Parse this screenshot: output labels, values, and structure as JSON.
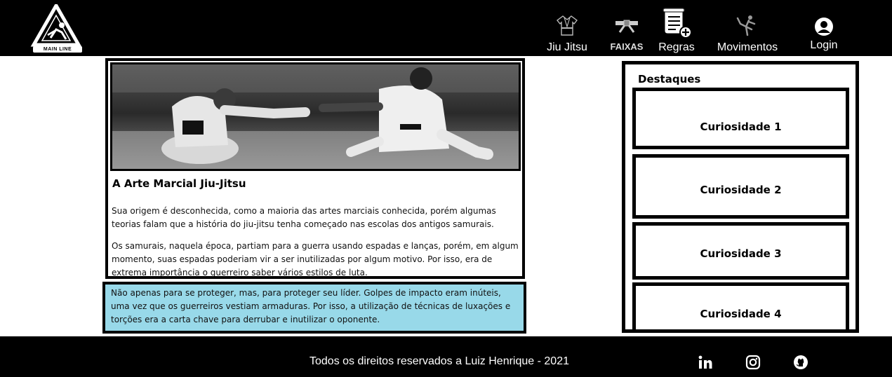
{
  "header": {
    "logo_text": "MAIN LINE",
    "nav": [
      {
        "label": "Jiu Jitsu",
        "icon": "gi-icon"
      },
      {
        "label": "FAIXAS",
        "icon": "belt-icon"
      },
      {
        "label": "Regras",
        "icon": "rules-scroll-icon"
      },
      {
        "label": "Movimentos",
        "icon": "kick-icon"
      },
      {
        "label": "Login",
        "icon": "user-icon"
      }
    ]
  },
  "article": {
    "title": "A Arte Marcial Jiu-Jitsu",
    "paragraphs": [
      "Sua origem é desconhecida, como a maioria das artes marciais conhecida, porém algumas teorias falam que a história do jiu-jitsu tenha começado nas escolas dos antigos samurais.",
      "Os samurais, naquela época, partiam para a guerra usando espadas e lanças, porém, em algum momento, suas espadas poderiam vir a ser inutilizadas por algum motivo. Por isso, era de extrema importância o guerreiro saber vários estilos de luta."
    ],
    "highlight": "Não apenas para se proteger, mas, para proteger seu líder. Golpes de impacto eram inúteis, uma vez que os guerreiros vestiam armaduras. Por isso, a utilização de técnicas de luxações e torções era a carta chave para derrubar e inutilizar o oponente.",
    "highlight_color": "#98d9e9"
  },
  "sidebar": {
    "title": "Destaques",
    "items": [
      "Curiosidade 1",
      "Curiosidade 2",
      "Curiosidade 3",
      "Curiosidade 4"
    ]
  },
  "footer": {
    "copyright": "Todos os direitos reservados a Luiz Henrique - 2021",
    "social": [
      "linkedin-icon",
      "instagram-icon",
      "github-icon"
    ]
  }
}
